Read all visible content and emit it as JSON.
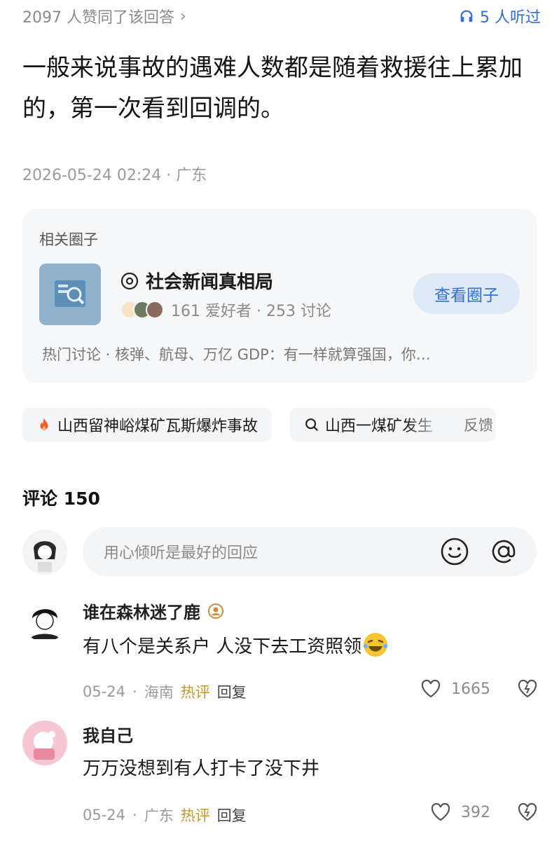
{
  "header": {
    "likes_text": "2097 人赞同了该回答",
    "chevron": "›",
    "listened_text": "5 人听过",
    "listened_icon": "headphones-icon"
  },
  "answer": {
    "body": "一般来说事故的遇难人数都是随着救援往上累加的，第一次看到回调的。",
    "meta": "2026-05-24 02:24 · 广东"
  },
  "circle": {
    "section_title": "相关圈子",
    "name": "社会新闻真相局",
    "stats": "161 爱好者 · 253 讨论",
    "view_button": "查看圈子",
    "hot_line": "热门讨论 · 核弹、航母、万亿 GDP：有一样就算强国，你…"
  },
  "chips": {
    "hot_topic": "山西留神峪煤矿瓦斯爆炸事故",
    "search_topic": "山西一煤矿发生",
    "feedback": "反馈"
  },
  "comments_section": {
    "title": "评论 150",
    "compose_placeholder": "用心倾听是最好的回应"
  },
  "comments": [
    {
      "username": "谁在森林迷了鹿",
      "text": "有八个是关系户 人没下去工资照领",
      "date": "05-24",
      "location": "海南",
      "hot_label": "热评",
      "reply_label": "回复",
      "like_count": "1665"
    },
    {
      "username": "我自己",
      "text": "万万没想到有人打卡了没下井",
      "date": "05-24",
      "location": "广东",
      "hot_label": "热评",
      "reply_label": "回复",
      "like_count": "392"
    }
  ],
  "colors": {
    "accent_blue": "#2f6fd6",
    "hot_gold": "#c9962a",
    "muted_gray": "#9a9a9a"
  }
}
